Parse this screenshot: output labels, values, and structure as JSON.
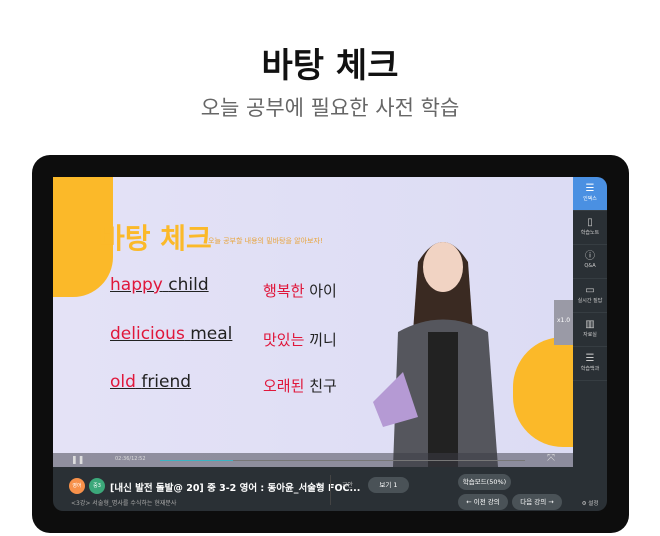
{
  "header": {
    "title": "바탕 체크",
    "subtitle": "오늘 공부에 필요한 사전 학습"
  },
  "slide": {
    "title": "바탕 체크",
    "subtitle": "오늘 공부할 내용의 밑바탕을 알아보자!",
    "rows": [
      {
        "en_adj": "happy",
        "en_noun": "child",
        "ko_adj": "행복한",
        "ko_noun": "아이"
      },
      {
        "en_adj": "delicious",
        "en_noun": "meal",
        "ko_adj": "맛있는",
        "ko_noun": "끼니"
      },
      {
        "en_adj": "old",
        "en_noun": "friend",
        "ko_adj": "오래된",
        "ko_noun": "친구"
      }
    ]
  },
  "player": {
    "time": "02:36/12:52",
    "progress": 0.2,
    "speed": "x1.0"
  },
  "lecture": {
    "badge1": "영어",
    "badge2": "중3",
    "title": "[내신 발전 돌발@ 20] 중 3-2 영어 : 동아윤_서술형 FOC...",
    "subtitle": "<3강> 서술형_명사를 수식하는 현재분사",
    "material_label": "·교안",
    "view_button": "보기 1",
    "mode_button": "학습모드(50%)",
    "prev_button": "← 이전 강의",
    "next_button": "다음 강의 →"
  },
  "sidebar": {
    "items": [
      {
        "label": "인덱스",
        "icon": "index-icon"
      },
      {
        "label": "학습노트",
        "icon": "notebook-icon"
      },
      {
        "label": "Q&A",
        "icon": "question-icon"
      },
      {
        "label": "실시간 질답",
        "icon": "chat-icon"
      },
      {
        "label": "자료실",
        "icon": "archive-icon"
      },
      {
        "label": "학습백과",
        "icon": "encyclopedia-icon"
      }
    ],
    "settings": "⚙ 설정"
  },
  "colors": {
    "accent": "#fbb929",
    "highlight": "#e0173b",
    "sidebar_active": "#4a90e2"
  }
}
